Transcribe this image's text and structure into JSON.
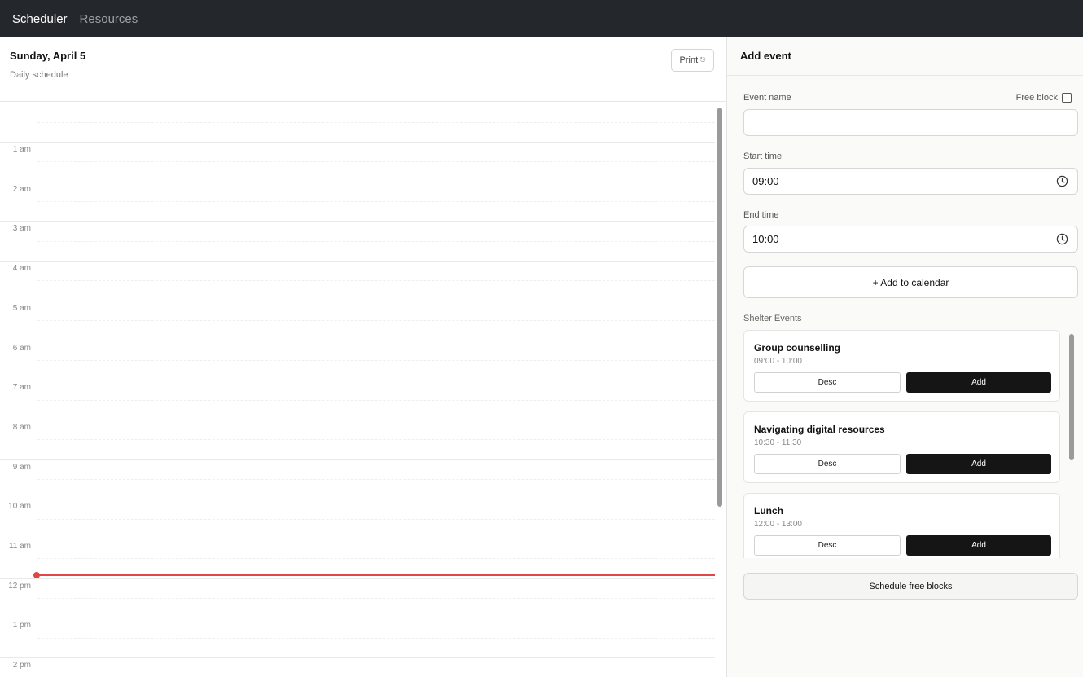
{
  "nav": {
    "items": [
      {
        "label": "Scheduler",
        "active": true
      },
      {
        "label": "Resources",
        "active": false
      }
    ]
  },
  "schedule": {
    "date_title": "Sunday, April 5",
    "subtitle": "Daily schedule",
    "print_label": "Print",
    "hour_labels": [
      "1 am",
      "2 am",
      "3 am",
      "4 am",
      "5 am",
      "6 am",
      "7 am",
      "8 am",
      "9 am",
      "10 am",
      "11 am",
      "12 pm",
      "1 pm",
      "2 pm"
    ],
    "now_line_color": "#e04646"
  },
  "form": {
    "title": "Add event",
    "event_name_label": "Event name",
    "event_name_value": "",
    "free_block_label": "Free block",
    "free_block_checked": false,
    "start_label": "Start time",
    "start_value": "09:00",
    "end_label": "End time",
    "end_value": "10:00",
    "add_button": "+ Add to calendar",
    "clock_icon": "clock-icon"
  },
  "shelter": {
    "section_label": "Shelter Events",
    "events": [
      {
        "name": "Group counselling",
        "time": "09:00 - 10:00",
        "desc_label": "Desc",
        "add_label": "Add"
      },
      {
        "name": "Navigating digital resources",
        "time": "10:30 - 11:30",
        "desc_label": "Desc",
        "add_label": "Add"
      },
      {
        "name": "Lunch",
        "time": "12:00 - 13:00",
        "desc_label": "Desc",
        "add_label": "Add"
      }
    ]
  },
  "schedule_free_blocks": "Schedule free blocks"
}
